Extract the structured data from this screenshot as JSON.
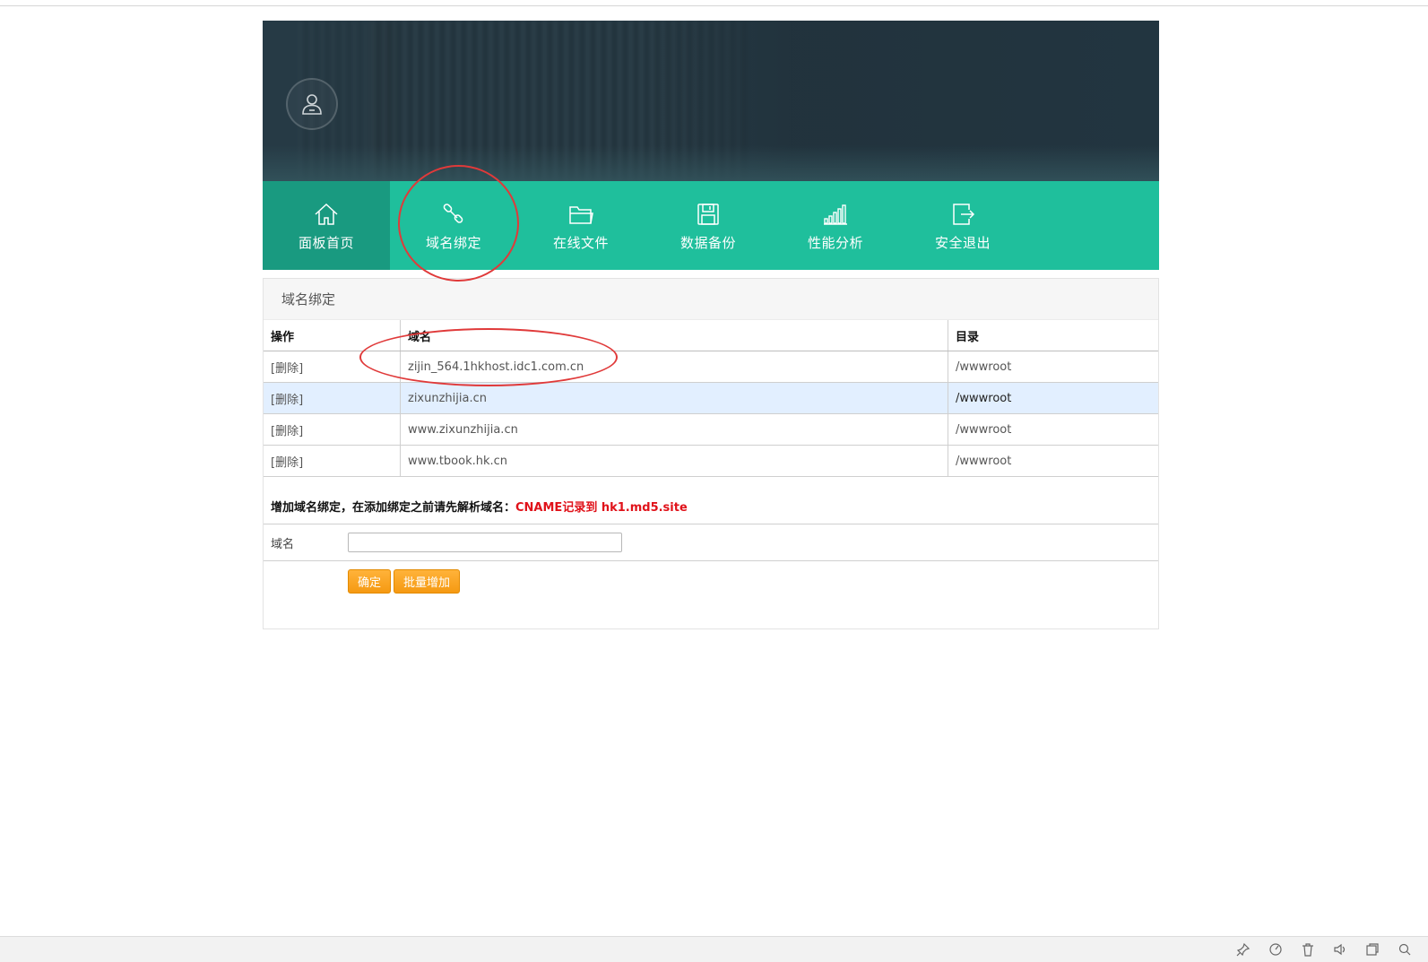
{
  "nav": {
    "items": [
      {
        "label": "面板首页",
        "icon": "home-icon",
        "active": true
      },
      {
        "label": "域名绑定",
        "icon": "link-icon",
        "active": false
      },
      {
        "label": "在线文件",
        "icon": "folder-icon",
        "active": false
      },
      {
        "label": "数据备份",
        "icon": "save-icon",
        "active": false
      },
      {
        "label": "性能分析",
        "icon": "bar-chart-icon",
        "active": false
      },
      {
        "label": "安全退出",
        "icon": "logout-icon",
        "active": false
      }
    ]
  },
  "panel": {
    "title": "域名绑定",
    "table": {
      "headers": [
        "操作",
        "域名",
        "目录"
      ],
      "rows": [
        {
          "action": "[删除]",
          "domain": "zijin_564.1hkhost.idc1.com.cn",
          "dir": "/wwwroot"
        },
        {
          "action": "[删除]",
          "domain": "zixunzhijia.cn",
          "dir": "/wwwroot"
        },
        {
          "action": "[删除]",
          "domain": "www.zixunzhijia.cn",
          "dir": "/wwwroot"
        },
        {
          "action": "[删除]",
          "domain": "www.tbook.hk.cn",
          "dir": "/wwwroot"
        }
      ]
    },
    "add": {
      "title": "增加域名绑定，在添加绑定之前请先解析域名：",
      "hint": "CNAME记录到 hk1.md5.site",
      "field_label": "域名",
      "field_value": "",
      "confirm_label": "确定",
      "batch_label": "批量增加"
    }
  },
  "colors": {
    "nav_bg": "#1fbf9c",
    "nav_active": "#199a80",
    "banner_bg": "#263a45",
    "highlight_row": "#e2efff",
    "button": "#f59a12",
    "hint_red": "#e0121a",
    "annotation_red": "#e03a3a"
  },
  "statusbar": {
    "icons": [
      "pin-icon",
      "speed-icon",
      "trash-icon",
      "volume-icon",
      "window-icon",
      "zoom-icon"
    ]
  }
}
